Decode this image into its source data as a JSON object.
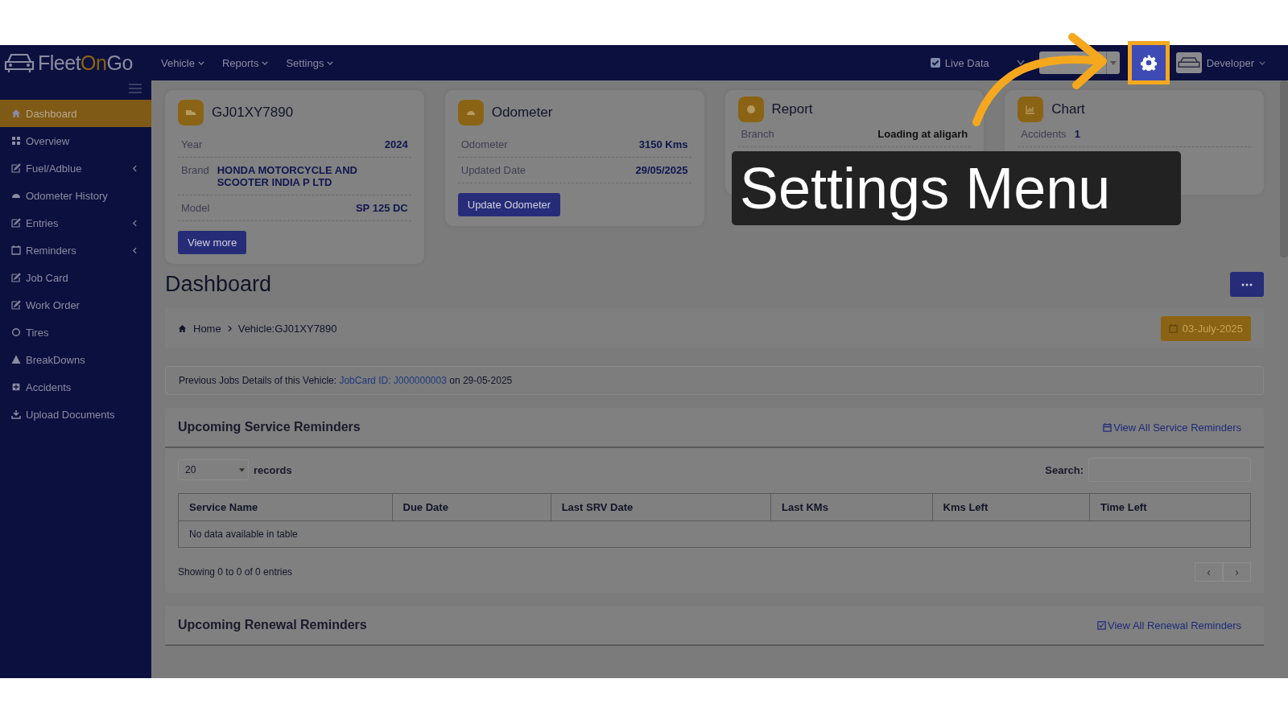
{
  "topbar": {
    "logo": {
      "part1": "Fleet",
      "part2": "On",
      "part3": "Go"
    },
    "nav": [
      {
        "label": "Vehicle"
      },
      {
        "label": "Reports"
      },
      {
        "label": "Settings"
      }
    ],
    "live_data": {
      "label": "Live Data",
      "checked": true
    },
    "user": {
      "name": "Developer"
    }
  },
  "sidebar": {
    "items": [
      {
        "label": "Dashboard",
        "selected": true,
        "expandable": false
      },
      {
        "label": "Overview",
        "selected": false,
        "expandable": false
      },
      {
        "label": "Fuel/Adblue",
        "selected": false,
        "expandable": true
      },
      {
        "label": "Odometer History",
        "selected": false,
        "expandable": false
      },
      {
        "label": "Entries",
        "selected": false,
        "expandable": true
      },
      {
        "label": "Reminders",
        "selected": false,
        "expandable": true
      },
      {
        "label": "Job Card",
        "selected": false,
        "expandable": false
      },
      {
        "label": "Work Order",
        "selected": false,
        "expandable": false
      },
      {
        "label": "Tires",
        "selected": false,
        "expandable": false
      },
      {
        "label": "BreakDowns",
        "selected": false,
        "expandable": false
      },
      {
        "label": "Accidents",
        "selected": false,
        "expandable": false
      },
      {
        "label": "Upload Documents",
        "selected": false,
        "expandable": false
      }
    ]
  },
  "cards": [
    {
      "kind": "vehicle",
      "title": "GJ01XY7890",
      "rows": [
        {
          "label": "Year",
          "value": "2024"
        },
        {
          "label": "Brand",
          "value": "HONDA MOTORCYCLE AND SCOOTER INDIA P LTD"
        },
        {
          "label": "Model",
          "value": "SP 125 DC"
        }
      ],
      "button": "View more"
    },
    {
      "kind": "odometer",
      "title": "Odometer",
      "rows": [
        {
          "label": "Odometer",
          "value": "3150 Kms"
        },
        {
          "label": "Updated Date",
          "value": "29/05/2025"
        }
      ],
      "button": "Update Odometer"
    },
    {
      "kind": "report",
      "title": "Report",
      "rows": [
        {
          "label": "Branch",
          "value": "Loading at aligarh"
        }
      ]
    },
    {
      "kind": "chart",
      "title": "Chart",
      "rows": [
        {
          "label": "Accidents",
          "value": "1"
        }
      ]
    }
  ],
  "page_title": "Dashboard",
  "breadcrumb": {
    "home": "Home",
    "current": "Vehicle:GJ01XY7890",
    "date": "03-July-2025"
  },
  "notice": {
    "text": "Previous Jobs Details of this Vehicle: ",
    "link": "JobCard ID: J000000003",
    "suffix": " on 29-05-2025"
  },
  "service_reminders": {
    "title": "Upcoming Service Reminders",
    "link": "View All Service Reminders",
    "page_size": "20",
    "records_label": "records",
    "search_label": "Search:",
    "columns": [
      "Service Name",
      "Due Date",
      "Last SRV Date",
      "Last KMs",
      "Kms Left",
      "Time Left"
    ],
    "empty": "No data available in table",
    "info": "Showing 0 to 0 of 0 entries",
    "prev": "‹",
    "next": "›"
  },
  "renewal_reminders": {
    "title": "Upcoming Renewal Reminders",
    "link": "View All Renewal Reminders"
  },
  "tutorial": {
    "caption": "Settings Menu"
  }
}
